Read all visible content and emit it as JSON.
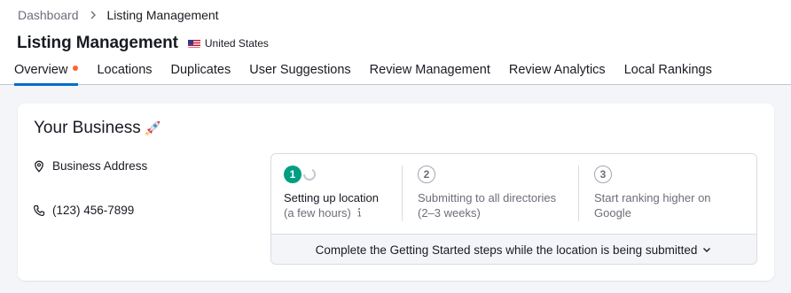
{
  "breadcrumb": {
    "parent": "Dashboard",
    "current": "Listing Management"
  },
  "header": {
    "title": "Listing Management",
    "country": "United States"
  },
  "tabs": [
    {
      "label": "Overview",
      "active": true,
      "has_dot": true
    },
    {
      "label": "Locations"
    },
    {
      "label": "Duplicates"
    },
    {
      "label": "User Suggestions"
    },
    {
      "label": "Review Management"
    },
    {
      "label": "Review Analytics"
    },
    {
      "label": "Local Rankings"
    }
  ],
  "business": {
    "title": "Your Business",
    "address": "Business Address",
    "phone": "(123) 456-7899"
  },
  "steps": [
    {
      "number": "1",
      "title": "Setting up location",
      "subtitle": "(a few hours)",
      "status": "in-progress"
    },
    {
      "number": "2",
      "title": "Submitting to all directories",
      "subtitle": "(2–3 weeks)",
      "status": "pending"
    },
    {
      "number": "3",
      "title": "Start ranking higher on",
      "subtitle": "Google",
      "status": "pending"
    }
  ],
  "footer": {
    "text": "Complete the Getting Started steps while the location is being submitted"
  },
  "colors": {
    "accent": "#006dca",
    "notify_dot": "#ff642d",
    "step_done": "#009f81",
    "page_bg": "#f4f5f9"
  }
}
